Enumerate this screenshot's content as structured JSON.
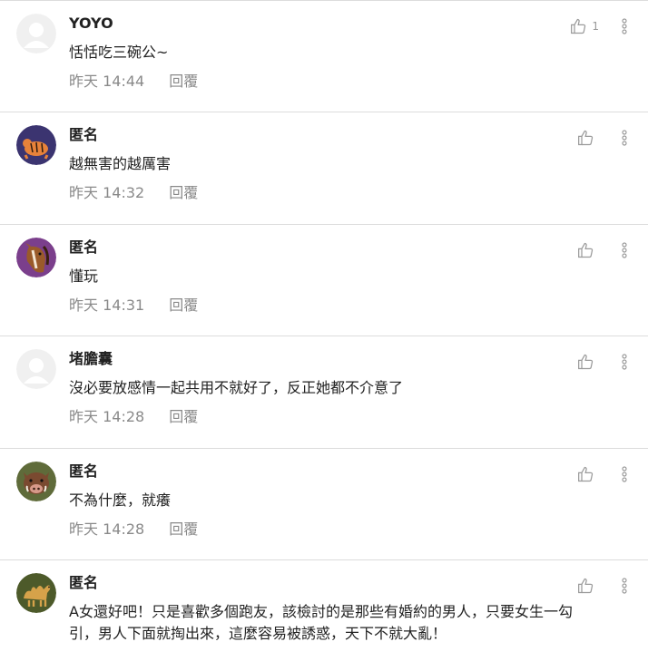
{
  "comments": [
    {
      "author": "YOYO",
      "text": "恬恬吃三碗公~",
      "time": "昨天 14:44",
      "reply": "回覆",
      "likes": "1",
      "avatar": "default-avatar"
    },
    {
      "author": "匿名",
      "text": "越無害的越厲害",
      "time": "昨天 14:32",
      "reply": "回覆",
      "likes": "",
      "avatar": "tiger-avatar"
    },
    {
      "author": "匿名",
      "text": "懂玩",
      "time": "昨天 14:31",
      "reply": "回覆",
      "likes": "",
      "avatar": "horse-avatar"
    },
    {
      "author": "堵膽囊",
      "text": "沒必要放感情一起共用不就好了，反正她都不介意了",
      "time": "昨天 14:28",
      "reply": "回覆",
      "likes": "",
      "avatar": "default-avatar"
    },
    {
      "author": "匿名",
      "text": "不為什麼，就癢",
      "time": "昨天 14:28",
      "reply": "回覆",
      "likes": "",
      "avatar": "boar-avatar"
    },
    {
      "author": "匿名",
      "text": "A女還好吧！只是喜歡多個跑友，該檢討的是那些有婚約的男人，只要女生一勾引，男人下面就掏出來，這麼容易被誘惑，天下不就大亂！",
      "time": "",
      "reply": "",
      "likes": "",
      "avatar": "camel-avatar"
    }
  ],
  "colors": {
    "divider": "#dcdcdc",
    "meta": "#8a8a8a",
    "icon": "#9a9a9a"
  }
}
